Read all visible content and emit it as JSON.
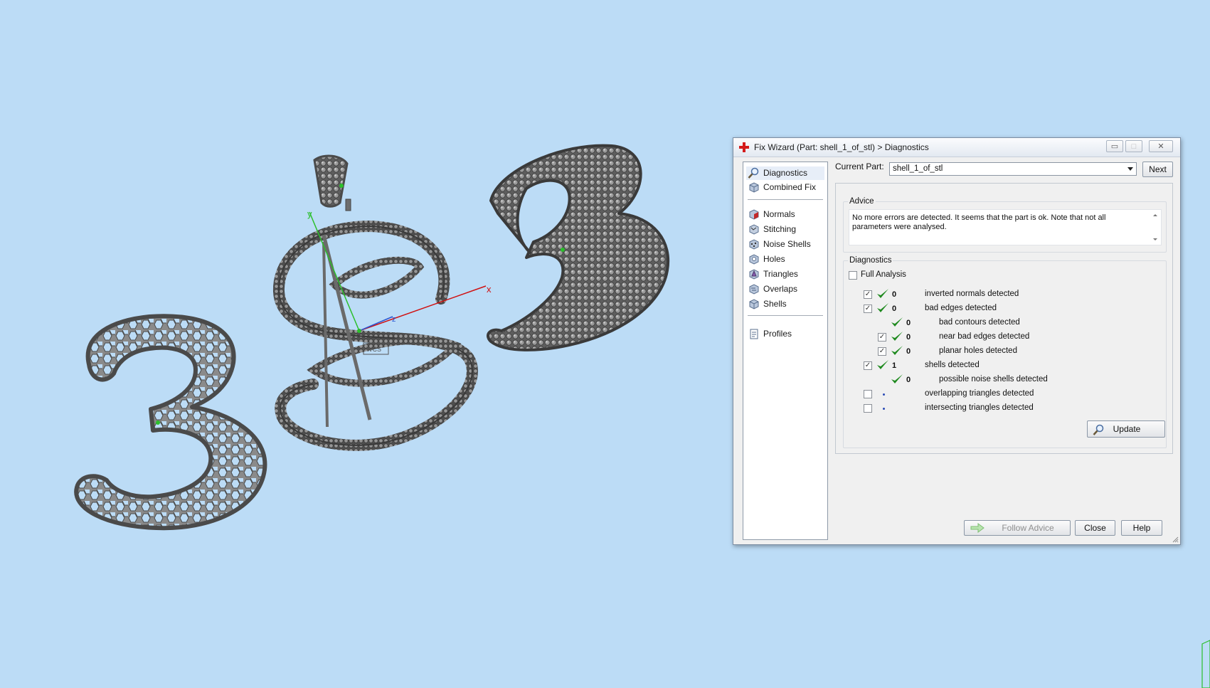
{
  "viewport": {
    "axis_labels": {
      "x": "x",
      "y": "y",
      "z": "z"
    },
    "wcs_label": "WCS",
    "models": [
      "letter-3-honeycomb",
      "letter-s-frame",
      "letter-b-pave"
    ]
  },
  "dialog": {
    "title": "Fix Wizard (Part: shell_1_of_stl) > Diagnostics",
    "window_buttons": {
      "minimize": "▭",
      "maximize": "□",
      "close": "✕"
    },
    "nav": {
      "items": [
        {
          "label": "Diagnostics",
          "icon": "magnifier-icon",
          "selected": true
        },
        {
          "label": "Combined Fix",
          "icon": "cube-icon"
        },
        {
          "label": "Normals",
          "icon": "normals-cube-icon"
        },
        {
          "label": "Stitching",
          "icon": "stitching-icon"
        },
        {
          "label": "Noise Shells",
          "icon": "noise-shells-icon"
        },
        {
          "label": "Holes",
          "icon": "holes-icon"
        },
        {
          "label": "Triangles",
          "icon": "triangles-icon"
        },
        {
          "label": "Overlaps",
          "icon": "overlaps-icon"
        },
        {
          "label": "Shells",
          "icon": "shells-icon"
        },
        {
          "label": "Profiles",
          "icon": "profiles-icon"
        }
      ]
    },
    "current_part": {
      "label": "Current Part:",
      "value": "shell_1_of_stl"
    },
    "next_label": "Next",
    "advice": {
      "title": "Advice",
      "text": "No more errors are detected. It seems that the part is ok. Note that not all parameters were analysed."
    },
    "diagnostics": {
      "title": "Diagnostics",
      "full_analysis": {
        "label": "Full Analysis",
        "checked": false
      },
      "rows": [
        {
          "checkbox": true,
          "checked": true,
          "ok": true,
          "count": "0",
          "label": "inverted normals detected",
          "indent": 0
        },
        {
          "checkbox": true,
          "checked": true,
          "ok": true,
          "count": "0",
          "label": "bad edges detected",
          "indent": 0
        },
        {
          "checkbox": false,
          "checked": false,
          "ok": true,
          "count": "0",
          "label": "bad contours detected",
          "indent": 1
        },
        {
          "checkbox": true,
          "checked": true,
          "ok": true,
          "count": "0",
          "label": "near bad edges detected",
          "indent": 1
        },
        {
          "checkbox": true,
          "checked": true,
          "ok": true,
          "count": "0",
          "label": "planar holes detected",
          "indent": 1
        },
        {
          "checkbox": true,
          "checked": true,
          "ok": true,
          "count": "1",
          "label": "shells detected",
          "indent": 0
        },
        {
          "checkbox": false,
          "checked": false,
          "ok": true,
          "count": "0",
          "label": "possible noise shells detected",
          "indent": 1
        },
        {
          "checkbox": true,
          "checked": false,
          "ok": false,
          "count": "",
          "label": "overlapping triangles detected",
          "indent": 0
        },
        {
          "checkbox": true,
          "checked": false,
          "ok": false,
          "count": "",
          "label": "intersecting triangles detected",
          "indent": 0
        }
      ],
      "update_label": "Update"
    },
    "footer": {
      "follow_advice_label": "Follow Advice",
      "close_label": "Close",
      "help_label": "Help"
    }
  },
  "colors": {
    "background": "#bcdcf6",
    "metal": "#7a7a7a",
    "axis_x": "#d01010",
    "axis_y": "#2bbf2b",
    "axis_z": "#2b55d0",
    "ok_tick": "#1f8a1f"
  }
}
